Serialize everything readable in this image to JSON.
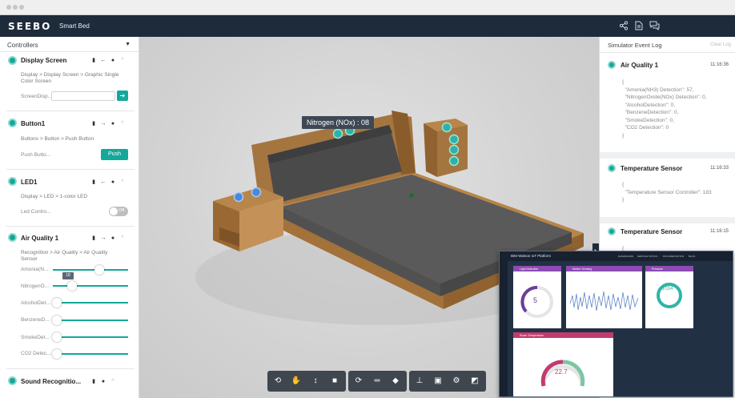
{
  "app": {
    "logo": "SEEBO",
    "name": "Smart Bed"
  },
  "nav_icons": [
    "share-icon",
    "document-icon",
    "chat-icon"
  ],
  "accent": "#14a89a",
  "controllers": {
    "title": "Controllers",
    "items": [
      {
        "name": "Display Screen",
        "path": "Display > Display Screen > Graphic Single Color Screen",
        "field": "ScreenDisp...",
        "arrow": "←"
      },
      {
        "name": "Button1",
        "path": "Buttons > Button > Push Button",
        "field": "Push Butto...",
        "button": "Push",
        "arrow": "→"
      },
      {
        "name": "LED1",
        "path": "Display > LED > 1-color LED",
        "field": "Led Contro...",
        "toggle": "Off",
        "arrow": "←"
      },
      {
        "name": "Air Quality 1",
        "path": "Recognition > Air Quality > Air Quality Sensor",
        "arrow": "→",
        "sliders": [
          {
            "label": "Amonia(N...",
            "value": 57
          },
          {
            "label": "NitrogenO...",
            "value": 8
          },
          {
            "label": "AlcoholDet...",
            "value": 0
          },
          {
            "label": "BenzeneD...",
            "value": 0
          },
          {
            "label": "SmokeDet...",
            "value": 0
          },
          {
            "label": "CO2 Detec...",
            "value": 0
          }
        ],
        "tooltip": "18"
      },
      {
        "name": "Sound Recognitio...",
        "arrow": ""
      }
    ]
  },
  "scene": {
    "label": "Nitrogen (NOx) : 08",
    "toolbar_groups": [
      [
        "rotate-icon",
        "hand-icon",
        "vertical-move-icon",
        "camera-icon"
      ],
      [
        "cube-rotate-icon",
        "ruler-icon",
        "box-icon"
      ],
      [
        "hierarchy-icon",
        "component-icon",
        "gear-icon",
        "screenshot-icon"
      ]
    ]
  },
  "event_log": {
    "title": "Simulator Event Log",
    "clear": "Clear Log",
    "events": [
      {
        "name": "Air Quality 1",
        "time": "11:16:36",
        "body": "{\n  \"Amonia(NH3) Detection\": 57,\n  \"NitrogenOxide(NOx) Detection\": 0,\n  \"AlcoholDetection\": 0,\n  \"BenzeneDetection\": 0,\n  \"SmokeDetection\": 0,\n  \"CO2 Detection\": 0\n}"
      },
      {
        "name": "Temperature Sensor",
        "time": "11:16:33",
        "body": "{\n  \"Temperature Sensor Controller\": 183\n}"
      },
      {
        "name": "Temperature Sensor",
        "time": "11:16:15",
        "body": "{"
      }
    ]
  },
  "iot": {
    "title": "IBM Watson IoT Platform",
    "nav": [
      "DASHBOARD",
      "SERVICE STATUS",
      "DOCUMENTATION",
      "BLOG"
    ],
    "cards": [
      {
        "title": "Light Detection",
        "color": "#8d4bb4",
        "value": "5"
      },
      {
        "title": "Motion Sensing",
        "color": "#8d4bb4"
      },
      {
        "title": "Pressure",
        "color": "#8d4bb4",
        "value": "1034"
      },
      {
        "title": "Room Temperature",
        "color": "#c23b6f",
        "value": "22.7"
      }
    ]
  }
}
